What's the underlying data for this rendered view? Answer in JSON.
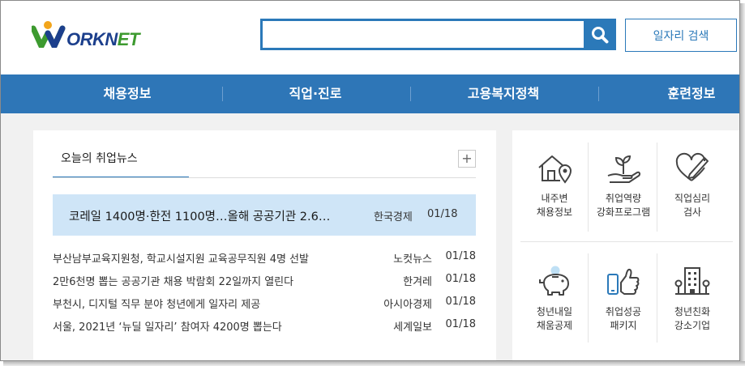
{
  "header": {
    "logo": {
      "prefix": "W",
      "middle": "ORKN",
      "suffix": "ET"
    },
    "search": {
      "placeholder": "",
      "value": "",
      "button_icon": "search-icon"
    },
    "job_search_label": "일자리 검색"
  },
  "nav": {
    "items": [
      {
        "label": "채용정보"
      },
      {
        "label": "직업·진로"
      },
      {
        "label": "고용복지정책"
      },
      {
        "label": "훈련정보"
      }
    ]
  },
  "news": {
    "tab_label": "오늘의 취업뉴스",
    "more_icon": "plus-icon",
    "headline": {
      "title": "코레일 1400명·한전 1100명…올해 공공기관 2.6…",
      "source": "한국경제",
      "date": "01/18"
    },
    "items": [
      {
        "title": "부산남부교육지원청, 학교시설지원 교육공무직원 4명 선발",
        "source": "노컷뉴스",
        "date": "01/18"
      },
      {
        "title": "2만6천명 뽑는 공공기관 채용 박람회 22일까지 열린다",
        "source": "한겨레",
        "date": "01/18"
      },
      {
        "title": "부천시, 디지털 직무 분야 청년에게 일자리 제공",
        "source": "아시아경제",
        "date": "01/18"
      },
      {
        "title": "서울, 2021년 ‘뉴딜 일자리’ 참여자 4200명 뽑는다",
        "source": "세계일보",
        "date": "01/18"
      }
    ]
  },
  "services": [
    {
      "line1": "내주변",
      "line2": "채용정보",
      "icon": "house-location-icon"
    },
    {
      "line1": "취업역량",
      "line2": "강화프로그램",
      "icon": "plant-hand-icon"
    },
    {
      "line1": "직업심리",
      "line2": "검사",
      "icon": "heart-pencil-icon"
    },
    {
      "line1": "청년내일",
      "line2": "채움공제",
      "icon": "piggy-bank-icon"
    },
    {
      "line1": "취업성공",
      "line2": "패키지",
      "icon": "thumbs-up-phone-icon"
    },
    {
      "line1": "청년친화",
      "line2": "강소기업",
      "icon": "building-icon"
    }
  ],
  "colors": {
    "brand_blue": "#2b79b9",
    "nav_blue": "#2e76b7",
    "headline_bg": "#cfe5f7",
    "logo_green": "#3d9a2f",
    "logo_navy": "#1c3f8c"
  }
}
